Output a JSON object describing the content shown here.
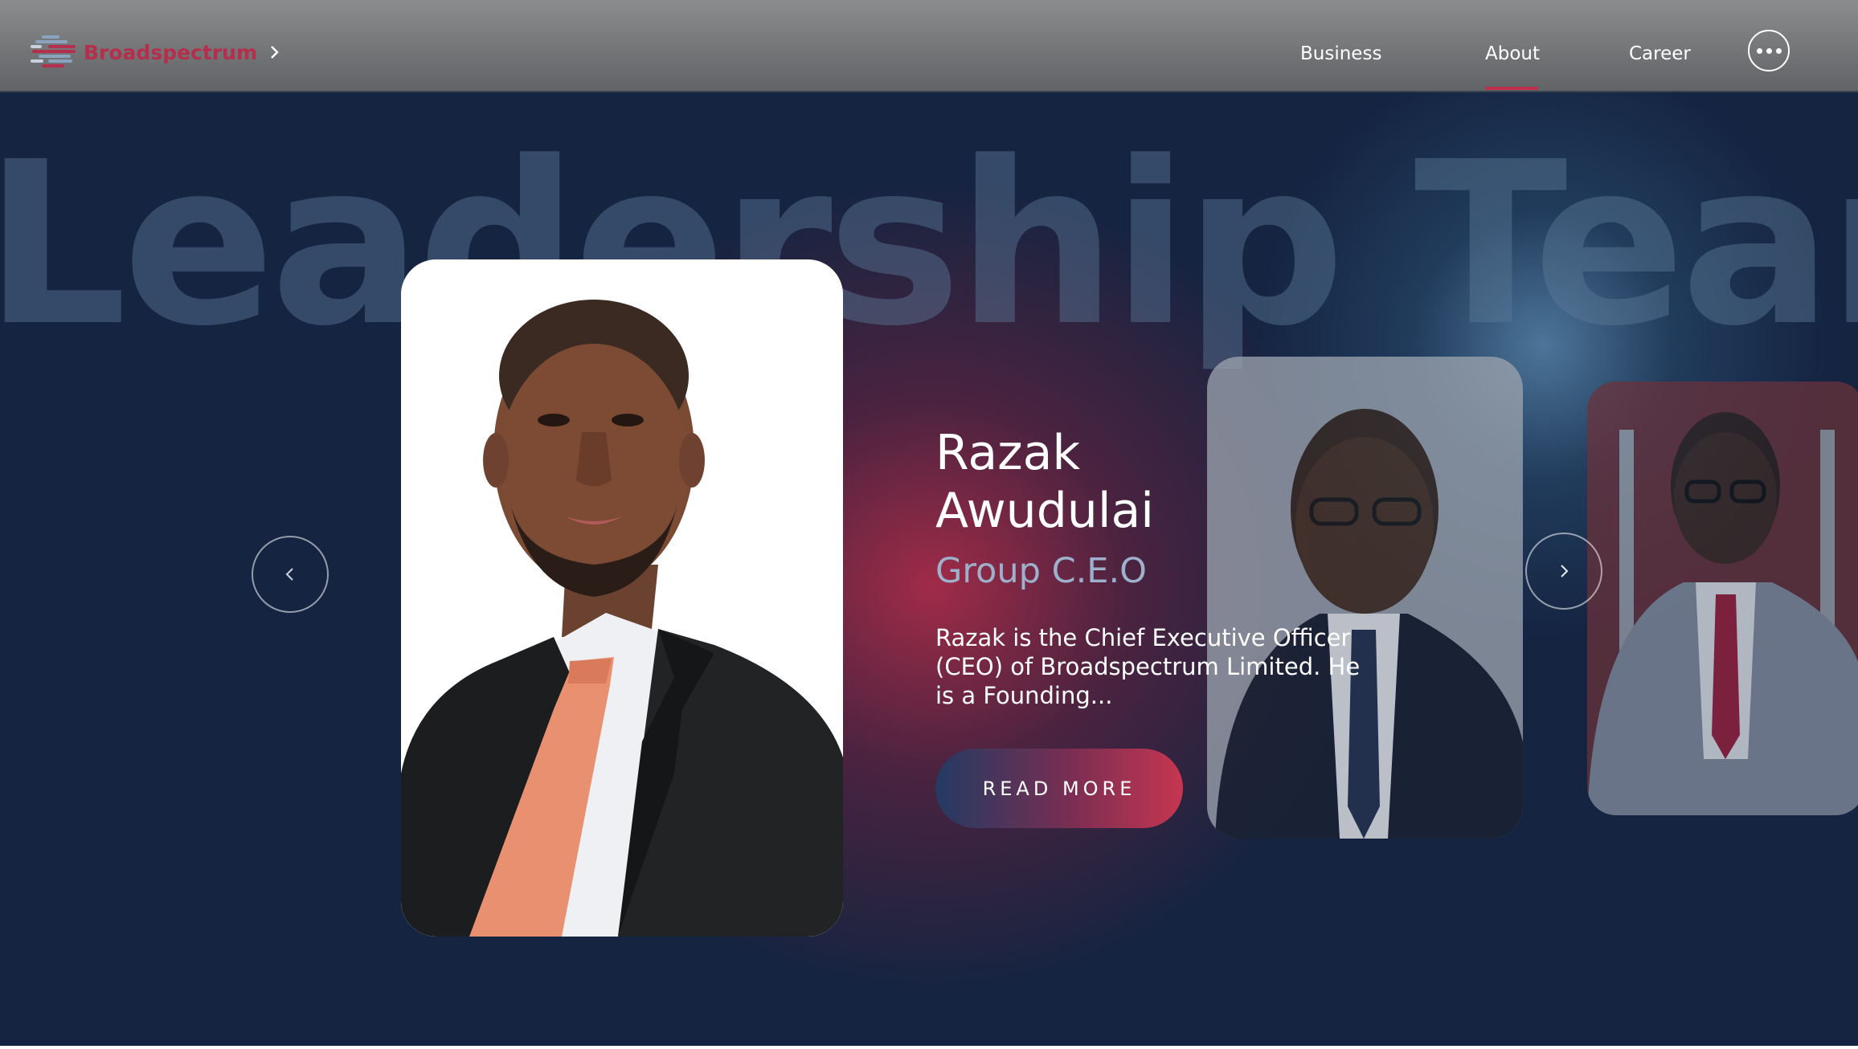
{
  "header": {
    "brand_name": "Broadspectrum",
    "brand_color": "#b52e4c",
    "nav": [
      {
        "label": "Business",
        "active": false
      },
      {
        "label": "About",
        "active": true
      },
      {
        "label": "Career",
        "active": false
      }
    ],
    "active_indicator_color": "#c0304d",
    "icons": [
      "broadspectrum-logo-icon",
      "chevron-right-icon",
      "more-options-icon"
    ]
  },
  "hero": {
    "background_title": "Leadership Team",
    "background_color": "#142441",
    "carousel": {
      "prev_icon": "chevron-left-icon",
      "next_icon": "chevron-right-icon"
    },
    "featured": {
      "name": "Razak Awudulai",
      "role": "Group C.E.O",
      "description": "Razak is the Chief Executive Officer (CEO) of Broadspectrum Limited. He is a Founding...",
      "button_label": "READ MORE"
    },
    "accent_colors": {
      "red": "#c63650",
      "blue": "#243a62",
      "role_text": "#9db0cc"
    }
  }
}
